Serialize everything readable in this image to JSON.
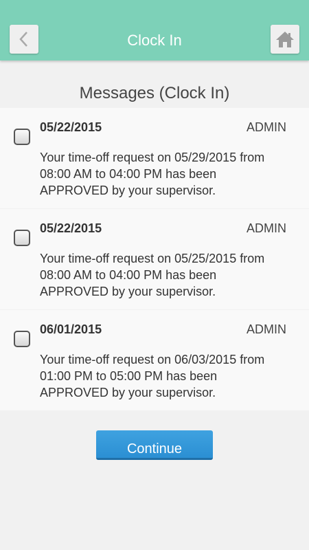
{
  "header": {
    "title": "Clock In",
    "back_icon": "chevron-left-icon",
    "home_icon": "home-icon"
  },
  "section_title": "Messages (Clock In)",
  "messages": [
    {
      "date": "05/22/2015",
      "sender": "ADMIN",
      "text": "Your time-off request on 05/29/2015 from 08:00 AM to 04:00 PM has been APPROVED by your supervisor.",
      "checked": false
    },
    {
      "date": "05/22/2015",
      "sender": "ADMIN",
      "text": "Your time-off request on 05/25/2015 from 08:00 AM to 04:00 PM has been APPROVED by your supervisor.",
      "checked": false
    },
    {
      "date": "06/01/2015",
      "sender": "ADMIN",
      "text": "Your time-off request on 06/03/2015 from 01:00 PM to 05:00 PM has been APPROVED by your supervisor.",
      "checked": false
    }
  ],
  "continue_label": "Continue",
  "colors": {
    "header": "#7dd1b8",
    "button": "#3498db"
  }
}
